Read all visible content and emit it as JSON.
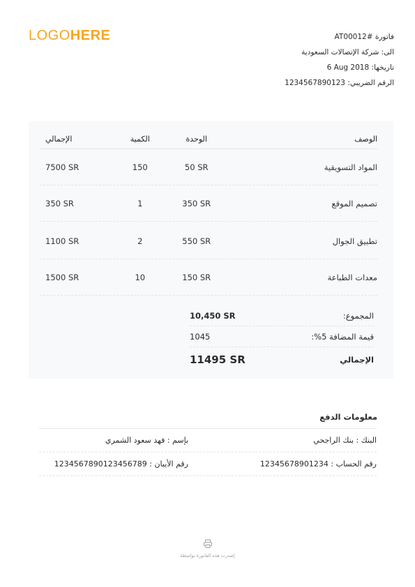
{
  "logo": {
    "light": "LOGO",
    "bold": "HERE",
    "color": "#f5a623"
  },
  "header": {
    "invoice_label": "فاتورة #",
    "invoice_number": "AT00012",
    "to_label": "الى:",
    "to_value": "شركة الإتصالات السعودية",
    "date_label": "تاريخها:",
    "date_value": "6 Aug 2018",
    "tax_label": "الرقم الضريبي:",
    "tax_value": "1234567890123"
  },
  "table": {
    "headers": {
      "description": "الوصف",
      "unit": "الوحدة",
      "quantity": "الكمية",
      "total": "الإجمالي"
    },
    "rows": [
      {
        "description": "المواد التسويقية",
        "unit": "50 SR",
        "quantity": "150",
        "total": "7500 SR"
      },
      {
        "description": "تصميم الموقع",
        "unit": "350 SR",
        "quantity": "1",
        "total": "350 SR"
      },
      {
        "description": "تطبيق الجوال",
        "unit": "550 SR",
        "quantity": "2",
        "total": "1100 SR"
      },
      {
        "description": "معدات الطباعة",
        "unit": "150 SR",
        "quantity": "10",
        "total": "1500 SR"
      }
    ]
  },
  "summary": {
    "subtotal_label": "المجموع:",
    "subtotal_value": "10,450 SR",
    "vat_label": "قيمة المضافة 5%:",
    "vat_value": "1045",
    "grand_label": "الإجمالي",
    "grand_value": "11495 SR"
  },
  "payment": {
    "title": "معلومات الدفع",
    "bank": "البنك : بنك الراجحي",
    "name": "بإسم : فهد سعود الشمري",
    "account": "رقم الحساب : 12345678901234",
    "iban": "رقم الأيبان : 1234567890123456789"
  },
  "footer": {
    "icon": "printer-icon",
    "note": "إصدرت هذه الفاتورة بواسطة"
  },
  "colors": {
    "accent": "#f5a623",
    "panel_bg": "#f8f9fb"
  }
}
